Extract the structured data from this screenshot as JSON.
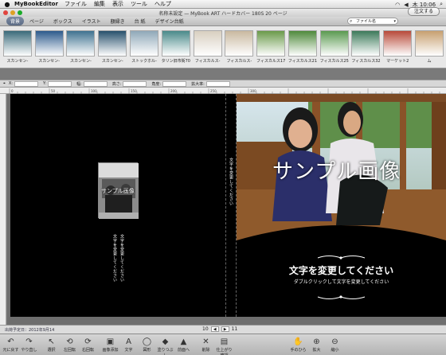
{
  "menubar": {
    "app_name": "MyBookEditor",
    "items": [
      "ファイル",
      "編集",
      "表示",
      "ツール",
      "ヘルプ"
    ],
    "clock": "木 10:06"
  },
  "window": {
    "title": "名称未設定 — MyBook ART ハードカバー 180S 20 ページ"
  },
  "tabs": [
    "背景",
    "ページ",
    "ボックス",
    "イラスト",
    "額縁き",
    "台 紙",
    "デザイン台紙"
  ],
  "search": {
    "value": "ファイル名"
  },
  "thumbnails": [
    {
      "label": "スカンセン-",
      "color": "#3a6a7a"
    },
    {
      "label": "スカンセン-",
      "color": "#2d5a8c"
    },
    {
      "label": "スカンセン-",
      "color": "#3f7290"
    },
    {
      "label": "スカンセン-",
      "color": "#28506c"
    },
    {
      "label": "ストックホル-",
      "color": "#8fa8b8"
    },
    {
      "label": "タリン旧市街70",
      "color": "#4a8a8a"
    },
    {
      "label": "フィスカルス-",
      "color": "#d8cfc0"
    },
    {
      "label": "フィスカルス-",
      "color": "#c9b9a0"
    },
    {
      "label": "フィスカルス17",
      "color": "#6a9a4a"
    },
    {
      "label": "フィスカルス21",
      "color": "#4f8a3c"
    },
    {
      "label": "フィスカルス25",
      "color": "#5a9a50"
    },
    {
      "label": "フィスカルス32",
      "color": "#3d7a5a"
    },
    {
      "label": "マーケット2",
      "color": "#b84a3a"
    },
    {
      "label": "ム",
      "color": "#c7a070"
    }
  ],
  "coords": {
    "x": "X:",
    "y": "Y:",
    "width": "幅:",
    "height": "高さ:",
    "angle": "角度:",
    "zoom": "拡大率:"
  },
  "ruler_marks": [
    "0",
    "50",
    "100",
    "150",
    "200",
    "250",
    "300"
  ],
  "cover": {
    "sample_label": "サンプル画像",
    "small_sample_label": "サンプル画像",
    "title": "文字を変更してください",
    "subtitle": "ダブルクリックして文字を変更してください",
    "spine_text": "文字を変更してください",
    "back_text_1": "文字を変更してください",
    "back_text_2": "文字を変更してください"
  },
  "status": {
    "date": "出荷予定日：2012年9月14"
  },
  "pagenav": {
    "left": "10",
    "right": "11"
  },
  "toolbar": [
    {
      "label": "元に戻す",
      "icon": "↶"
    },
    {
      "label": "やり直し",
      "icon": "↷"
    },
    {
      "label": "選択",
      "icon": "↖"
    },
    {
      "label": "左回転",
      "icon": "⟲"
    },
    {
      "label": "右回転",
      "icon": "⟳"
    },
    {
      "label": "画像添加",
      "icon": "▣"
    },
    {
      "label": "文字",
      "icon": "A"
    },
    {
      "label": "図形",
      "icon": "◯"
    },
    {
      "label": "塗りつぶし",
      "icon": "◆"
    },
    {
      "label": "前面へ",
      "icon": "▲"
    },
    {
      "label": "削除",
      "icon": "✕"
    },
    {
      "label": "仕上がり確認",
      "icon": "▤"
    },
    {
      "label": "手のひら",
      "icon": "✋"
    },
    {
      "label": "拡大",
      "icon": "⊕"
    },
    {
      "label": "縮小",
      "icon": "⊖"
    }
  ],
  "order_label": "注文する"
}
